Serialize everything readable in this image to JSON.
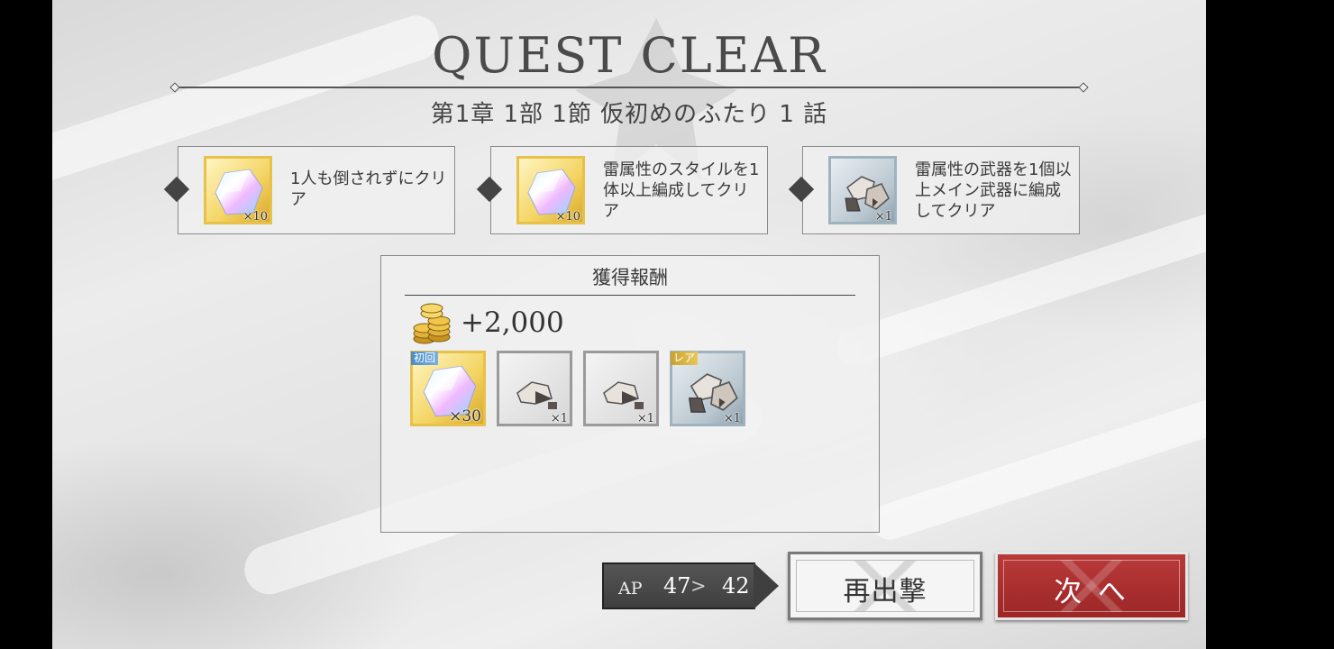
{
  "result": {
    "title": "QUEST CLEAR",
    "chapter": "第1章 1部 1節 仮初めのふたり 1 話"
  },
  "missions": [
    {
      "text": "1人も倒されずにクリア",
      "reward_icon": "crystal-icon",
      "quantity": "×10"
    },
    {
      "text": "雷属性のスタイルを1体以上編成してクリア",
      "reward_icon": "crystal-icon",
      "quantity": "×10"
    },
    {
      "text": "雷属性の武器を1個以上メイン武器に編成してクリア",
      "reward_icon": "ore-icon",
      "quantity": "×1"
    }
  ],
  "rewards": {
    "header": "獲得報酬",
    "gold": "+2,000",
    "items": [
      {
        "tag": "初回",
        "icon": "crystal-icon",
        "quantity": "×30"
      },
      {
        "tag": "",
        "icon": "ore-icon",
        "quantity": "×1"
      },
      {
        "tag": "",
        "icon": "ore-icon",
        "quantity": "×1"
      },
      {
        "tag": "レア",
        "icon": "ore-icon",
        "quantity": "×1"
      }
    ]
  },
  "ap": {
    "label": "AP",
    "from": "47",
    "separator": ">",
    "to": "42"
  },
  "buttons": {
    "retry": "再出撃",
    "next": "次 へ"
  },
  "colors": {
    "next_button": "#a92e2e",
    "gold_frame": "#e7c14a",
    "silver_frame": "#9fb3bf"
  }
}
